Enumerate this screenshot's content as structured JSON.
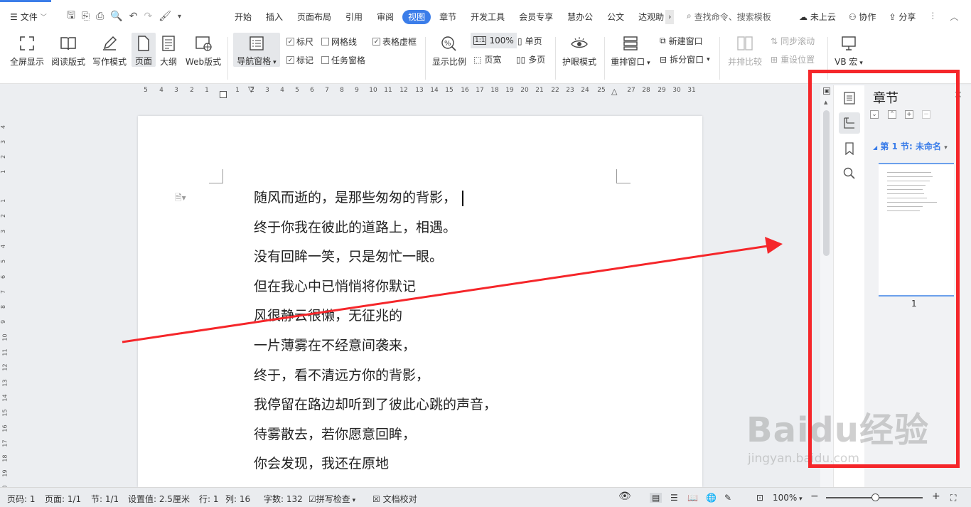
{
  "tabbar": {
    "file_label": "文件",
    "tabs": [
      "开始",
      "插入",
      "页面布局",
      "引用",
      "审阅",
      "视图",
      "章节",
      "开发工具",
      "会员专享",
      "慧办公",
      "公文",
      "达观助"
    ],
    "active_tab": "视图",
    "search_label": "查找命令、搜索模板",
    "upload_label": "未上云",
    "collab_label": "协作",
    "share_label": "分享"
  },
  "ribbon": {
    "fullscreen": "全屏显示",
    "read_mode": "阅读版式",
    "write_mode": "写作模式",
    "page": "页面",
    "outline": "大纲",
    "web": "Web版式",
    "nav_pane": "导航窗格",
    "ruler": "标尺",
    "gridlines": "网格线",
    "table_frame": "表格虚框",
    "marks": "标记",
    "task_pane": "任务窗格",
    "zoom": "显示比例",
    "hundred": "100%",
    "page_width": "页宽",
    "single_page": "单页",
    "multi_page": "多页",
    "eye_protect": "护眼模式",
    "arrange": "重排窗口",
    "new_window": "新建窗口",
    "split_window": "拆分窗口",
    "side_compare": "并排比较",
    "sync_scroll": "同步滚动",
    "reset_pos": "重设位置",
    "vb_macro": "VB 宏"
  },
  "ruler": {
    "h_ticks": [
      "5",
      "4",
      "3",
      "2",
      "1",
      "1",
      "2",
      "3",
      "4",
      "5",
      "6",
      "7",
      "8",
      "9",
      "10",
      "11",
      "12",
      "13",
      "14",
      "15",
      "16",
      "17",
      "18",
      "19",
      "20",
      "21",
      "22",
      "23",
      "24",
      "25",
      "27",
      "28",
      "29",
      "30",
      "31"
    ],
    "v_ticks": [
      "4",
      "3",
      "2",
      "1",
      "1",
      "2",
      "3",
      "4",
      "5",
      "6",
      "7",
      "8",
      "9",
      "10",
      "11",
      "12",
      "13",
      "14",
      "15",
      "16",
      "17",
      "18",
      "19",
      "20"
    ]
  },
  "document": {
    "lines": [
      "随风而逝的，是那些匆匆的背影，",
      "终于你我在彼此的道路上，相遇。",
      "没有回眸一笑，只是匆忙一眼。",
      "但在我心中已悄悄将你默记",
      "风很静云很懒，无征兆的",
      "一片薄雾在不经意间袭来，",
      "终于，看不清远方你的背影，",
      "我停留在路边却听到了彼此心跳的声音，",
      "待雾散去，若你愿意回眸，",
      "你会发现，我还在原地"
    ]
  },
  "panel": {
    "title": "章节",
    "section_label": "第 1 节: 未命名",
    "page_number": "1"
  },
  "watermark": {
    "brand": "Baidu经验",
    "url": "jingyan.baidu.com"
  },
  "status": {
    "page_code": "页码: 1",
    "pages": "页面: 1/1",
    "section": "节: 1/1",
    "setting": "设置值: 2.5厘米",
    "row": "行: 1",
    "col": "列: 16",
    "word_count": "字数: 132",
    "spell_check": "拼写检查",
    "doc_proof": "文档校对",
    "zoom_value": "100%"
  },
  "colors": {
    "accent": "#3b7de9",
    "annotation_red": "#f5262a"
  }
}
